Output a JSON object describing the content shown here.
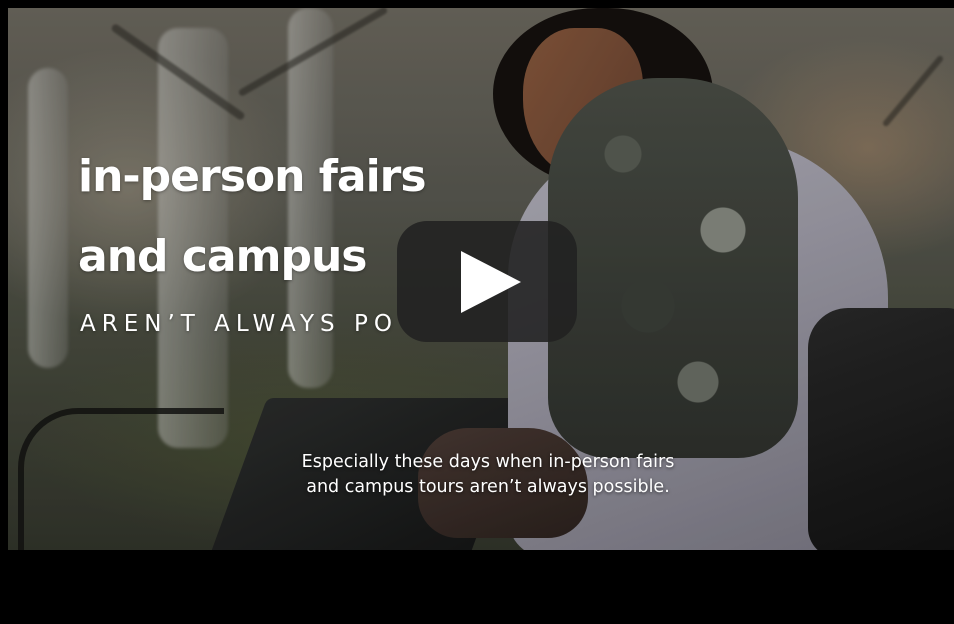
{
  "video": {
    "headline_line1": "in-person fairs",
    "headline_line2": "and campus",
    "subline": "AREN’T ALWAYS PO",
    "caption_line1": "Especially these days when in-person fairs",
    "caption_line2": "and campus tours aren’t always possible."
  },
  "controls": {
    "play_icon": "play-icon"
  },
  "colors": {
    "letterbox": "#000000",
    "play_button_bg": "#212121",
    "text": "#ffffff"
  }
}
